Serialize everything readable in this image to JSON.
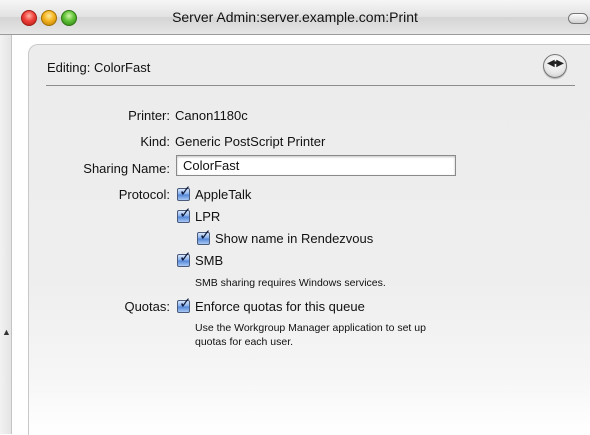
{
  "window": {
    "title": "Server Admin:server.example.com:Print"
  },
  "header": {
    "editing_label": "Editing: ColorFast",
    "action_icon": "action-menu-icon"
  },
  "form": {
    "printer_label": "Printer:",
    "printer_value": "Canon1180c",
    "kind_label": "Kind:",
    "kind_value": "Generic PostScript Printer",
    "sharing_name_label": "Sharing Name:",
    "sharing_name_value": "ColorFast",
    "protocol_label": "Protocol:",
    "protocols": {
      "appletalk": {
        "label": "AppleTalk",
        "checked": true
      },
      "lpr": {
        "label": "LPR",
        "checked": true
      },
      "rendezvous": {
        "label": "Show name in Rendezvous",
        "checked": true
      },
      "smb": {
        "label": "SMB",
        "checked": true
      }
    },
    "smb_note": "SMB sharing requires Windows services.",
    "quotas_label": "Quotas:",
    "quotas_checkbox": {
      "label": "Enforce quotas for this queue",
      "checked": true
    },
    "quotas_note_line1": "Use the Workgroup Manager application to set up",
    "quotas_note_line2": "quotas for each user."
  },
  "colors": {
    "checkbox_blue": "#4f82d6",
    "pane_bg": "#ececec"
  }
}
